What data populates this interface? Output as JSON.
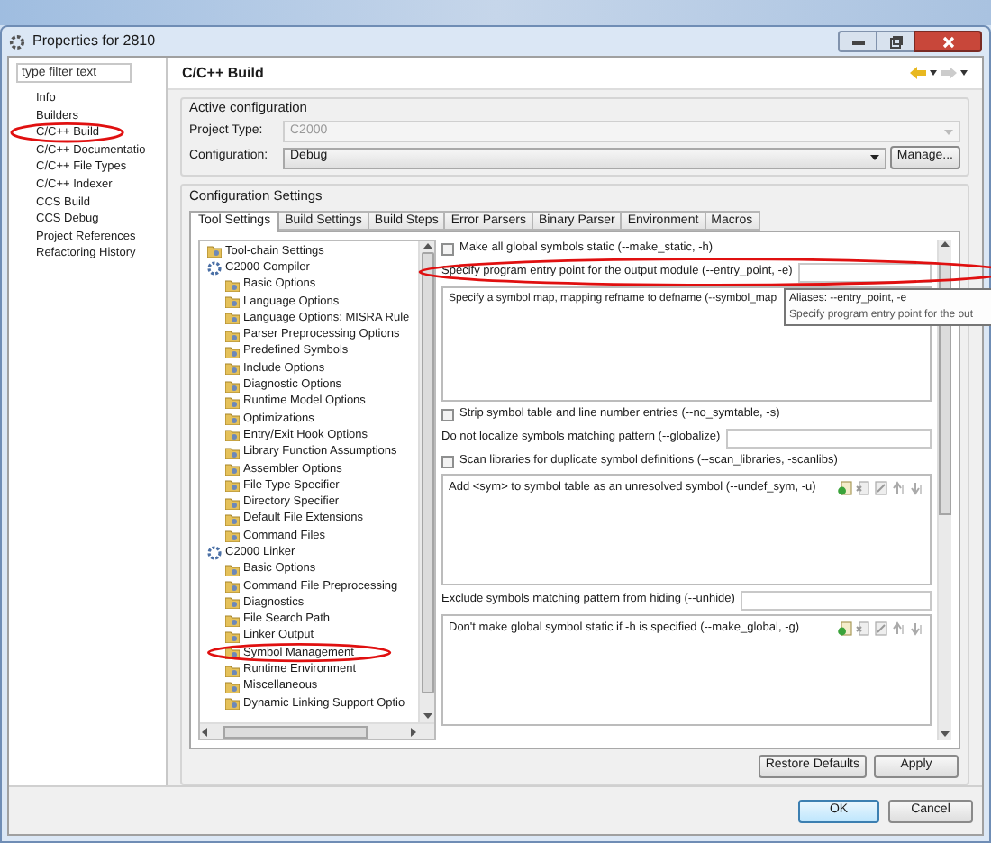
{
  "window": {
    "title": "Properties for 2810"
  },
  "filter": {
    "placeholder": "type filter text"
  },
  "sidebar": {
    "items": [
      {
        "label": "Info"
      },
      {
        "label": "Builders"
      },
      {
        "label": "C/C++ Build"
      },
      {
        "label": "C/C++ Documentatio"
      },
      {
        "label": "C/C++ File Types"
      },
      {
        "label": "C/C++ Indexer"
      },
      {
        "label": "CCS Build"
      },
      {
        "label": "CCS Debug"
      },
      {
        "label": "Project References"
      },
      {
        "label": "Refactoring History"
      }
    ]
  },
  "page_title": "C/C++ Build",
  "active_configuration": {
    "title": "Active configuration",
    "project_type_label": "Project Type:",
    "project_type": "C2000",
    "configuration_label": "Configuration:",
    "configuration": "Debug",
    "manage_button": "Manage..."
  },
  "settings": {
    "title": "Configuration Settings",
    "tabs": [
      {
        "label": "Tool Settings",
        "selected": true
      },
      {
        "label": "Build Settings",
        "selected": false
      },
      {
        "label": "Build Steps",
        "selected": false
      },
      {
        "label": "Error Parsers",
        "selected": false
      },
      {
        "label": "Binary Parser",
        "selected": false
      },
      {
        "label": "Environment",
        "selected": false
      },
      {
        "label": "Macros",
        "selected": false
      }
    ],
    "tree": [
      {
        "label": "Tool-chain Settings"
      },
      {
        "label": "C2000 Compiler",
        "children": [
          {
            "label": "Basic Options"
          },
          {
            "label": "Language Options"
          },
          {
            "label": "Language Options: MISRA Rule"
          },
          {
            "label": "Parser Preprocessing Options"
          },
          {
            "label": "Predefined Symbols"
          },
          {
            "label": "Include Options"
          },
          {
            "label": "Diagnostic Options"
          },
          {
            "label": "Runtime Model Options"
          },
          {
            "label": "Optimizations"
          },
          {
            "label": "Entry/Exit Hook Options"
          },
          {
            "label": "Library Function Assumptions"
          },
          {
            "label": "Assembler Options"
          },
          {
            "label": "File Type Specifier"
          },
          {
            "label": "Directory Specifier"
          },
          {
            "label": "Default File Extensions"
          },
          {
            "label": "Command Files"
          }
        ]
      },
      {
        "label": "C2000 Linker",
        "children": [
          {
            "label": "Basic Options"
          },
          {
            "label": "Command File Preprocessing"
          },
          {
            "label": "Diagnostics"
          },
          {
            "label": "File Search Path"
          },
          {
            "label": "Linker Output"
          },
          {
            "label": "Symbol Management"
          },
          {
            "label": "Runtime Environment"
          },
          {
            "label": "Miscellaneous"
          },
          {
            "label": "Dynamic Linking Support Optio"
          }
        ]
      }
    ],
    "options": [
      {
        "kind": "checkbox",
        "label": "Make all global symbols static (--make_static, -h)",
        "checked": false
      },
      {
        "kind": "text",
        "label": "Specify program entry point for the output module (--entry_point, -e)"
      },
      {
        "kind": "list",
        "label": "Specify a symbol map, mapping refname to defname (--symbol_map",
        "toolbar": false
      },
      {
        "kind": "checkbox",
        "label": "Strip symbol table and line number entries (--no_symtable, -s)",
        "checked": false
      },
      {
        "kind": "text",
        "label": "Do not localize symbols matching pattern (--globalize)"
      },
      {
        "kind": "checkbox",
        "label": "Scan libraries for duplicate symbol definitions (--scan_libraries, -scanlibs)",
        "checked": false
      },
      {
        "kind": "list",
        "label": "Add <sym> to symbol table as an unresolved symbol (--undef_sym, -u)",
        "toolbar": true
      },
      {
        "kind": "text",
        "label": "Exclude symbols matching pattern from hiding (--unhide)"
      },
      {
        "kind": "list",
        "label": "Don't make global symbol static if -h is specified (--make_global, -g)",
        "toolbar": true
      }
    ]
  },
  "tooltip": {
    "lines": [
      "Aliases: --entry_point, -e",
      "Specify program entry point for the out"
    ]
  },
  "buttons": {
    "restore": "Restore Defaults",
    "apply": "Apply",
    "ok": "OK",
    "cancel": "Cancel"
  }
}
